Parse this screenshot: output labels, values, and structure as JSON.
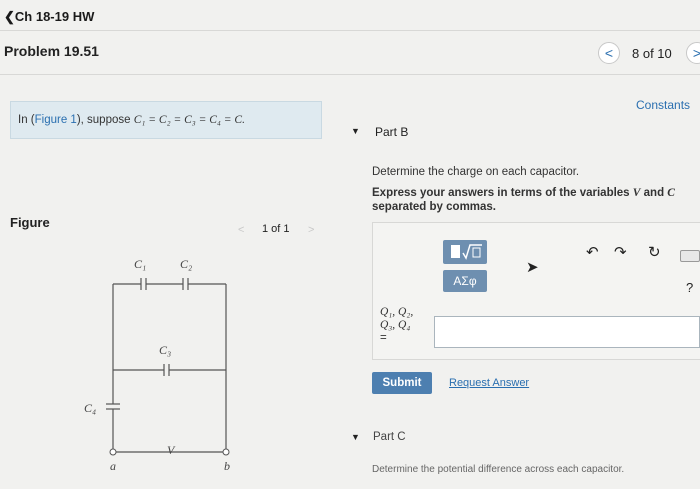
{
  "header": {
    "back_label": "Ch 18-19 HW",
    "back_icon": "chevron-left-icon"
  },
  "problem": {
    "title": "Problem 19.51",
    "nav": {
      "prev_glyph": "<",
      "next_glyph": ">",
      "count": "8 of 10"
    },
    "constants_label": "Constants"
  },
  "intro": {
    "prefix": "In (",
    "link": "Figure 1",
    "middle": "), suppose ",
    "equation": "C₁ = C₂ = C₃ = C₄ = C."
  },
  "figure": {
    "label": "Figure",
    "count": "1 of 1",
    "prev_glyph": "<",
    "next_glyph": ">",
    "labels": {
      "c1": "C₁",
      "c2": "C₂",
      "c3": "C₃",
      "c4": "C₄",
      "a": "a",
      "b": "b",
      "v": "V"
    }
  },
  "part_b": {
    "label": "Part B",
    "question": "Determine the charge on each capacitor.",
    "instruction_a": "Express your answers in terms of the variables ",
    "var_v": "V",
    "instruction_b": " and ",
    "var_c": "C",
    "instruction_c": " separated by commas.",
    "toolbar": {
      "greek_label": "ΑΣφ",
      "help_glyph": "?"
    },
    "var_line1": "Q₁, Q₂,",
    "var_line2": "Q₃, Q₄",
    "var_line3": "=",
    "answer_value": "",
    "submit_label": "Submit",
    "request_label": "Request Answer"
  },
  "part_c": {
    "label": "Part C",
    "text": "Determine the potential difference across each capacitor."
  },
  "colors": {
    "accent": "#2a6fb0",
    "submit": "#4d7fb0",
    "tool": "#6e8fb0",
    "intro_bg": "#dfeaf0"
  }
}
